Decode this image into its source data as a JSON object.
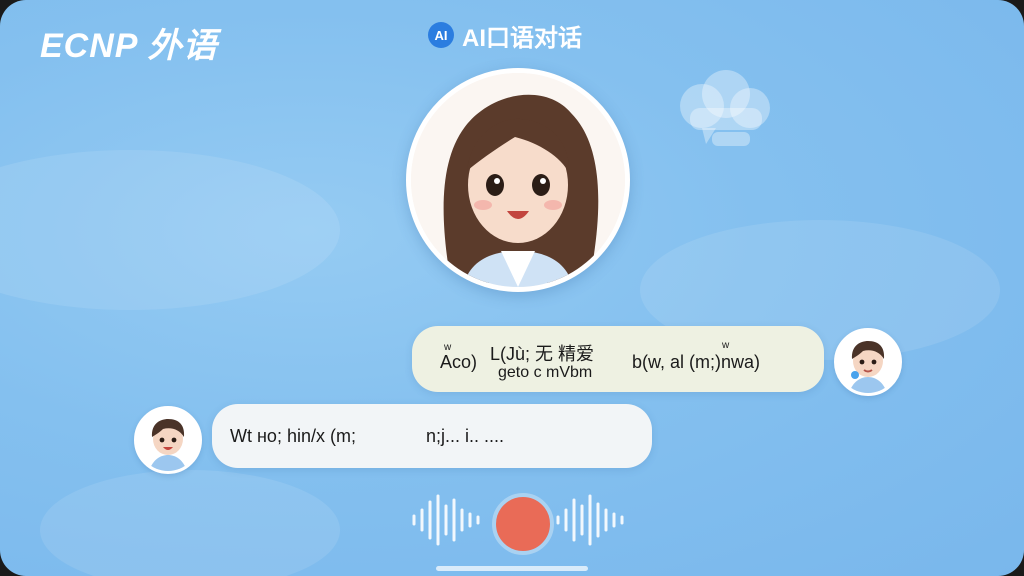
{
  "header": {
    "brand": "ECNP 外语",
    "title_badge": "AI",
    "title": "AI口语对话"
  },
  "chat": {
    "messages": [
      {
        "side": "right",
        "lines": [
          "Aco)",
          "L(Jù; 无  精爱",
          "ɡeto c mVbm",
          "b(w, al (m;)nwa)"
        ],
        "superscripts": [
          "w",
          "w"
        ]
      },
      {
        "side": "left",
        "text": "Wt нo; hin/x (m;",
        "text2": "n;j... i..  ...."
      }
    ]
  },
  "colors": {
    "background": "#84c0ef",
    "record_button": "#e96b57",
    "bubble_right": "#eef1e2",
    "bubble_left": "#f2f5f7"
  },
  "icons": {
    "cloud": "cloud-chat-icon",
    "record": "record-icon",
    "wave_left": "sound-wave-icon",
    "wave_right": "sound-wave-icon"
  }
}
